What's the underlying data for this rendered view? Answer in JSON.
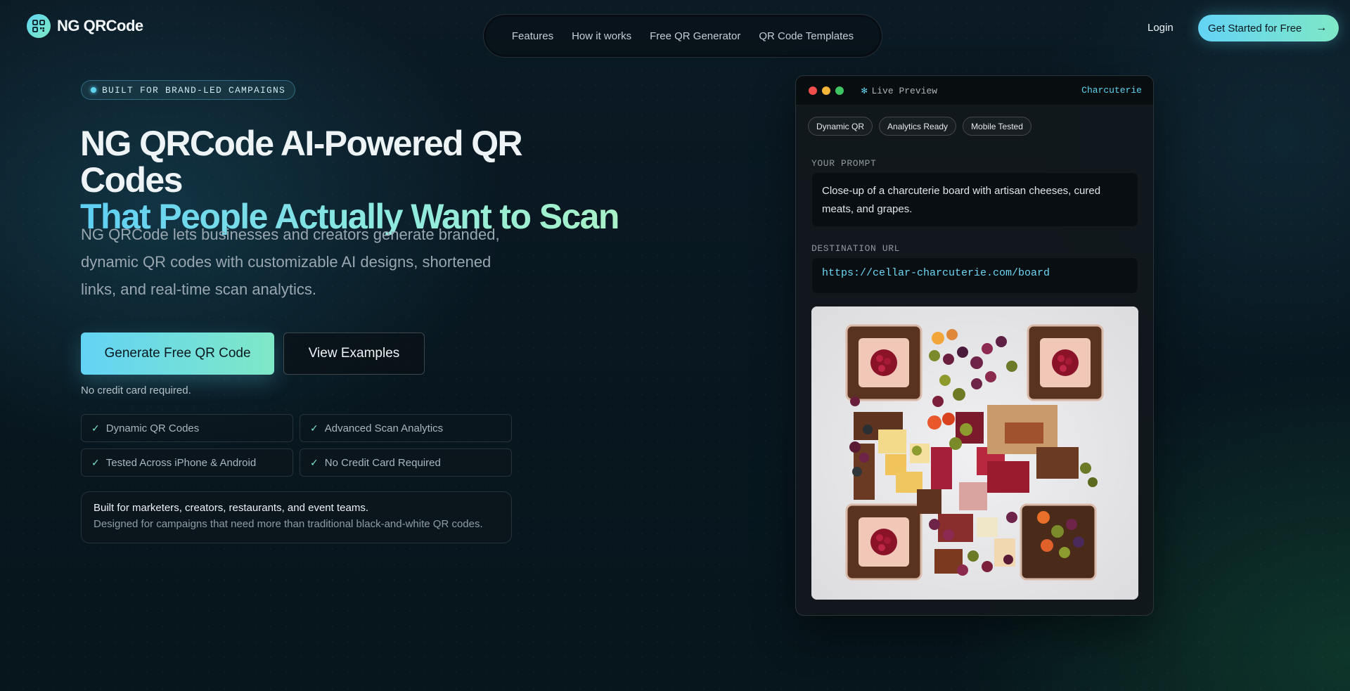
{
  "brand": {
    "name": "NG QRCode",
    "icon": "qr-code-icon"
  },
  "nav": {
    "links": [
      "Features",
      "How it works",
      "Free QR Generator",
      "QR Code Templates"
    ],
    "login": "Login",
    "cta": "Get Started for Free",
    "cta_icon": "arrow-right-icon"
  },
  "hero": {
    "badge": "BUILT FOR BRAND-LED CAMPAIGNS",
    "title_line1": "NG QRCode AI-Powered QR Codes",
    "title_line2": "That People Actually Want to Scan",
    "lead": "NG QRCode lets businesses and creators generate branded, dynamic QR codes with customizable AI designs, shortened links, and real-time scan analytics.",
    "primary_button": "Generate Free QR Code",
    "secondary_button": "View Examples",
    "note": "No credit card required.",
    "features": [
      "Dynamic QR Codes",
      "Advanced Scan Analytics",
      "Tested Across iPhone & Android",
      "No Credit Card Required"
    ],
    "info_title": "Built for marketers, creators, restaurants, and event teams.",
    "info_subtitle": "Designed for campaigns that need more than traditional black-and-white QR codes."
  },
  "preview": {
    "title": "Live Preview",
    "tag": "Charcuterie",
    "chips": [
      "Dynamic QR",
      "Analytics Ready",
      "Mobile Tested"
    ],
    "prompt_label": "YOUR PROMPT",
    "prompt": "Close-up of a charcuterie board with artisan cheeses, cured meats, and grapes.",
    "url_label": "DESTINATION URL",
    "url": "https://cellar-charcuterie.com/board"
  },
  "colors": {
    "accent_start": "#63d3f5",
    "accent_end": "#7fe8c6",
    "background": "#081720"
  }
}
